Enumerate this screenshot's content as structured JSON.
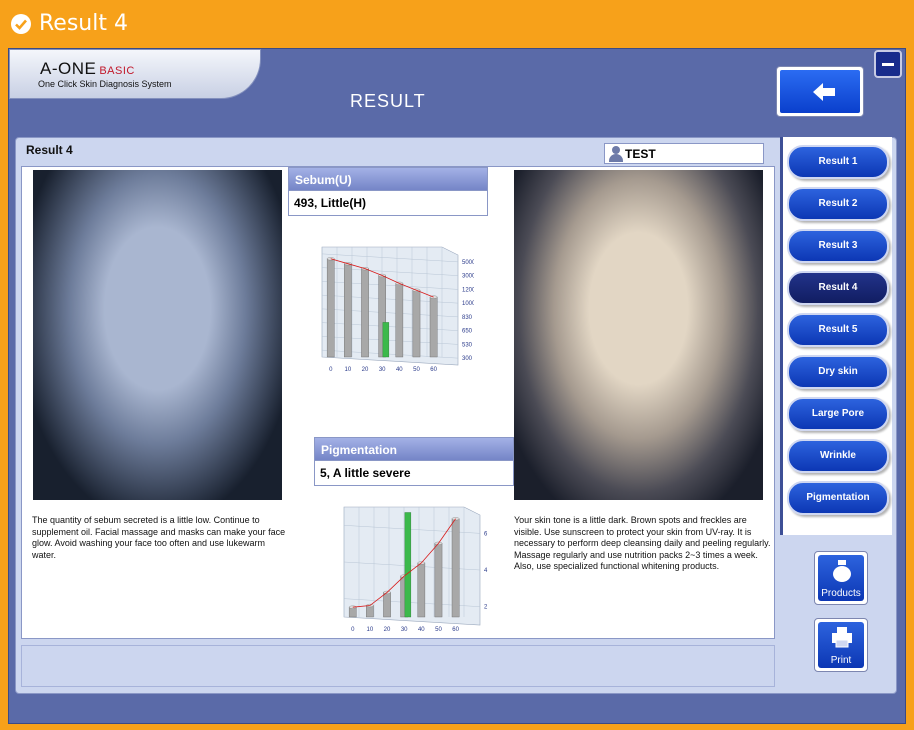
{
  "window": {
    "title": "Result 4"
  },
  "brand": {
    "name": "A-ONE",
    "edition": "BASIC",
    "tagline": "One Click Skin Diagnosis System"
  },
  "header": {
    "title": "RESULT",
    "back_label": "back"
  },
  "panel": {
    "heading": "Result 4",
    "user": "TEST"
  },
  "sebum": {
    "label": "Sebum(U)",
    "value": "493,  Little(H)"
  },
  "pigmentation": {
    "label": "Pigmentation",
    "value": "5,  A little severe"
  },
  "descriptions": {
    "left": "The quantity of sebum secreted is a little low. Continue to supplement oil. Facial massage and masks can make your face glow. Avoid washing your face too often and use lukewarm water.",
    "right": "Your skin tone is a little dark. Brown spots and freckles are visible. Use sunscreen to protect your skin from UV-ray. It is necessary to perform deep cleansing daily and peeling regularly. Massage regularly and use nutrition packs 2~3 times a week. Also, use specialized functional whitening products."
  },
  "sidebar": {
    "items": [
      {
        "label": "Result 1"
      },
      {
        "label": "Result 2"
      },
      {
        "label": "Result 3"
      },
      {
        "label": "Result 4",
        "active": true
      },
      {
        "label": "Result 5"
      },
      {
        "label": "Dry skin"
      },
      {
        "label": "Large Pore"
      },
      {
        "label": "Wrinkle"
      },
      {
        "label": "Pigmentation"
      }
    ]
  },
  "actions": {
    "products": "Products",
    "print": "Print"
  },
  "chart_data": [
    {
      "type": "bar",
      "title": "",
      "categories": [
        "0",
        "10",
        "20",
        "30",
        "40",
        "50",
        "60"
      ],
      "values": [
        1000,
        950,
        900,
        830,
        750,
        680,
        610
      ],
      "highlight": {
        "category": "30",
        "value": 493
      },
      "trend_line": true,
      "y_ticks": [
        "300",
        "530",
        "650",
        "830",
        "1000",
        "1200",
        "3000",
        "5000"
      ],
      "ylim": [
        300,
        5000
      ],
      "grid": true,
      "colors": {
        "bar": "#a8a8a8",
        "highlight": "#3cb94b",
        "line": "#d81a1a"
      }
    },
    {
      "type": "bar",
      "title": "",
      "categories": [
        "0",
        "10",
        "20",
        "30",
        "40",
        "50",
        "60"
      ],
      "values": [
        0.6,
        0.7,
        1.5,
        2.5,
        3.3,
        4.5,
        6.0
      ],
      "highlight": {
        "category": "30",
        "value": 5
      },
      "trend_line": true,
      "y_ticks": [
        "2",
        "4",
        "6"
      ],
      "ylim": [
        0,
        7
      ],
      "grid": true,
      "colors": {
        "bar": "#a8a8a8",
        "highlight": "#3cb94b",
        "line": "#d81a1a"
      }
    }
  ]
}
